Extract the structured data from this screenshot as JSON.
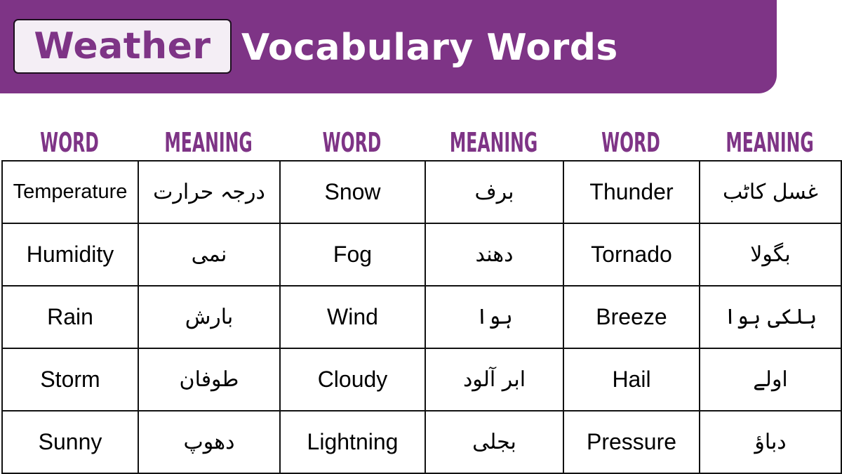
{
  "header": {
    "title_highlight": "Weather",
    "title_rest": "Vocabulary Words",
    "accent_color": "#7e3486"
  },
  "columns": [
    "WORD",
    "MEANING",
    "WORD",
    "MEANING",
    "WORD",
    "MEANING"
  ],
  "rows": [
    [
      {
        "word": "Temperature",
        "meaning": "درجہ حرارت"
      },
      {
        "word": "Snow",
        "meaning": "برف"
      },
      {
        "word": "Thunder",
        "meaning": "غسل کاٹب"
      }
    ],
    [
      {
        "word": "Humidity",
        "meaning": "نمی"
      },
      {
        "word": "Fog",
        "meaning": "دھند"
      },
      {
        "word": "Tornado",
        "meaning": "بگولا"
      }
    ],
    [
      {
        "word": "Rain",
        "meaning": "بارش"
      },
      {
        "word": "Wind",
        "meaning": "ہوا"
      },
      {
        "word": "Breeze",
        "meaning": "ہلکی ہوا"
      }
    ],
    [
      {
        "word": "Storm",
        "meaning": "طوفان"
      },
      {
        "word": "Cloudy",
        "meaning": "ابر آلود"
      },
      {
        "word": "Hail",
        "meaning": "اولے"
      }
    ],
    [
      {
        "word": "Sunny",
        "meaning": "دھوپ"
      },
      {
        "word": "Lightning",
        "meaning": "بجلی"
      },
      {
        "word": "Pressure",
        "meaning": "دباؤ"
      }
    ]
  ]
}
